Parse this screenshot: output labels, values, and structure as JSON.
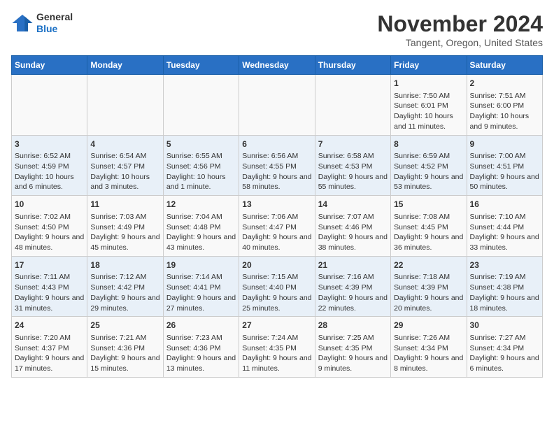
{
  "logo": {
    "general": "General",
    "blue": "Blue"
  },
  "title": "November 2024",
  "subtitle": "Tangent, Oregon, United States",
  "days_of_week": [
    "Sunday",
    "Monday",
    "Tuesday",
    "Wednesday",
    "Thursday",
    "Friday",
    "Saturday"
  ],
  "weeks": [
    [
      {
        "day": "",
        "info": ""
      },
      {
        "day": "",
        "info": ""
      },
      {
        "day": "",
        "info": ""
      },
      {
        "day": "",
        "info": ""
      },
      {
        "day": "",
        "info": ""
      },
      {
        "day": "1",
        "info": "Sunrise: 7:50 AM\nSunset: 6:01 PM\nDaylight: 10 hours and 11 minutes."
      },
      {
        "day": "2",
        "info": "Sunrise: 7:51 AM\nSunset: 6:00 PM\nDaylight: 10 hours and 9 minutes."
      }
    ],
    [
      {
        "day": "3",
        "info": "Sunrise: 6:52 AM\nSunset: 4:59 PM\nDaylight: 10 hours and 6 minutes."
      },
      {
        "day": "4",
        "info": "Sunrise: 6:54 AM\nSunset: 4:57 PM\nDaylight: 10 hours and 3 minutes."
      },
      {
        "day": "5",
        "info": "Sunrise: 6:55 AM\nSunset: 4:56 PM\nDaylight: 10 hours and 1 minute."
      },
      {
        "day": "6",
        "info": "Sunrise: 6:56 AM\nSunset: 4:55 PM\nDaylight: 9 hours and 58 minutes."
      },
      {
        "day": "7",
        "info": "Sunrise: 6:58 AM\nSunset: 4:53 PM\nDaylight: 9 hours and 55 minutes."
      },
      {
        "day": "8",
        "info": "Sunrise: 6:59 AM\nSunset: 4:52 PM\nDaylight: 9 hours and 53 minutes."
      },
      {
        "day": "9",
        "info": "Sunrise: 7:00 AM\nSunset: 4:51 PM\nDaylight: 9 hours and 50 minutes."
      }
    ],
    [
      {
        "day": "10",
        "info": "Sunrise: 7:02 AM\nSunset: 4:50 PM\nDaylight: 9 hours and 48 minutes."
      },
      {
        "day": "11",
        "info": "Sunrise: 7:03 AM\nSunset: 4:49 PM\nDaylight: 9 hours and 45 minutes."
      },
      {
        "day": "12",
        "info": "Sunrise: 7:04 AM\nSunset: 4:48 PM\nDaylight: 9 hours and 43 minutes."
      },
      {
        "day": "13",
        "info": "Sunrise: 7:06 AM\nSunset: 4:47 PM\nDaylight: 9 hours and 40 minutes."
      },
      {
        "day": "14",
        "info": "Sunrise: 7:07 AM\nSunset: 4:46 PM\nDaylight: 9 hours and 38 minutes."
      },
      {
        "day": "15",
        "info": "Sunrise: 7:08 AM\nSunset: 4:45 PM\nDaylight: 9 hours and 36 minutes."
      },
      {
        "day": "16",
        "info": "Sunrise: 7:10 AM\nSunset: 4:44 PM\nDaylight: 9 hours and 33 minutes."
      }
    ],
    [
      {
        "day": "17",
        "info": "Sunrise: 7:11 AM\nSunset: 4:43 PM\nDaylight: 9 hours and 31 minutes."
      },
      {
        "day": "18",
        "info": "Sunrise: 7:12 AM\nSunset: 4:42 PM\nDaylight: 9 hours and 29 minutes."
      },
      {
        "day": "19",
        "info": "Sunrise: 7:14 AM\nSunset: 4:41 PM\nDaylight: 9 hours and 27 minutes."
      },
      {
        "day": "20",
        "info": "Sunrise: 7:15 AM\nSunset: 4:40 PM\nDaylight: 9 hours and 25 minutes."
      },
      {
        "day": "21",
        "info": "Sunrise: 7:16 AM\nSunset: 4:39 PM\nDaylight: 9 hours and 22 minutes."
      },
      {
        "day": "22",
        "info": "Sunrise: 7:18 AM\nSunset: 4:39 PM\nDaylight: 9 hours and 20 minutes."
      },
      {
        "day": "23",
        "info": "Sunrise: 7:19 AM\nSunset: 4:38 PM\nDaylight: 9 hours and 18 minutes."
      }
    ],
    [
      {
        "day": "24",
        "info": "Sunrise: 7:20 AM\nSunset: 4:37 PM\nDaylight: 9 hours and 17 minutes."
      },
      {
        "day": "25",
        "info": "Sunrise: 7:21 AM\nSunset: 4:36 PM\nDaylight: 9 hours and 15 minutes."
      },
      {
        "day": "26",
        "info": "Sunrise: 7:23 AM\nSunset: 4:36 PM\nDaylight: 9 hours and 13 minutes."
      },
      {
        "day": "27",
        "info": "Sunrise: 7:24 AM\nSunset: 4:35 PM\nDaylight: 9 hours and 11 minutes."
      },
      {
        "day": "28",
        "info": "Sunrise: 7:25 AM\nSunset: 4:35 PM\nDaylight: 9 hours and 9 minutes."
      },
      {
        "day": "29",
        "info": "Sunrise: 7:26 AM\nSunset: 4:34 PM\nDaylight: 9 hours and 8 minutes."
      },
      {
        "day": "30",
        "info": "Sunrise: 7:27 AM\nSunset: 4:34 PM\nDaylight: 9 hours and 6 minutes."
      }
    ]
  ]
}
